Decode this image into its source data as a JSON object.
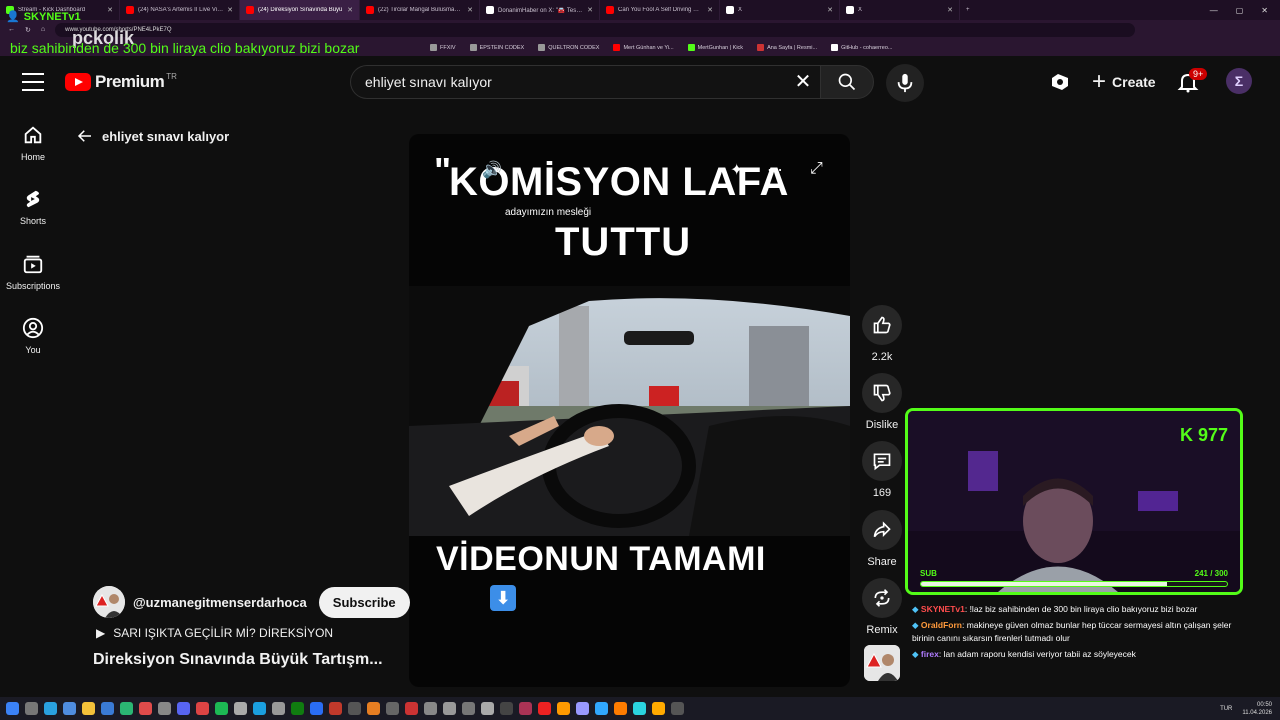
{
  "browser": {
    "tabs": [
      {
        "title": "Stream - Kick Dashboard",
        "color": "#53fc18",
        "active": false
      },
      {
        "title": "(24) NASA's Artemis II Live Views f",
        "color": "#ff0000",
        "active": false
      },
      {
        "title": "(24) Direksiyon Sınavında Büyü",
        "color": "#ff0000",
        "active": true
      },
      {
        "title": "(22) Tircilar Mangal Bulusmasi Vor",
        "color": "#ff0000",
        "active": false
      },
      {
        "title": "DonanimHaber on X: \"🚘 Tesla, Tü",
        "color": "#ffffff",
        "active": false
      },
      {
        "title": "Can You Fool A Self Driving Car?",
        "color": "#ff0000",
        "active": false
      },
      {
        "title": "X",
        "color": "#ffffff",
        "active": false
      },
      {
        "title": "X",
        "color": "#ffffff",
        "active": false
      }
    ],
    "url": "www.youtube.com/shorts/PNE4LPkE7Q",
    "bookmarks": [
      {
        "label": "FFXIV",
        "color": "#999999"
      },
      {
        "label": "EPSTEIN CODEX",
        "color": "#999999"
      },
      {
        "label": "QUELTRON CODEX",
        "color": "#999999"
      },
      {
        "label": "Mert Günhan ve Yi...",
        "color": "#ff0000"
      },
      {
        "label": "MertGunhan | Kick",
        "color": "#53fc18"
      },
      {
        "label": "Ana Sayfa | Resmi...",
        "color": "#cc3333"
      },
      {
        "label": "GitHub - cohaerreo...",
        "color": "#ffffff"
      }
    ]
  },
  "overlay": {
    "streamer": "SKYNETv1",
    "ticker": "biz sahibinden de 300 bin liraya clio bakıyoruz bizi bozar",
    "logo_text": "pckolik"
  },
  "yt_header": {
    "logo_word": "Premium",
    "region": "TR",
    "search_value": "ehliyet sınavı kalıyor",
    "create_label": "Create",
    "notif_badge": "9+",
    "accent": "#ff0000"
  },
  "nav": {
    "items": [
      {
        "label": "Home",
        "icon": "home-icon"
      },
      {
        "label": "Shorts",
        "icon": "shorts-icon"
      },
      {
        "label": "Subscriptions",
        "icon": "subscriptions-icon"
      },
      {
        "label": "You",
        "icon": "you-icon"
      }
    ]
  },
  "back": {
    "label": "ehliyet sınavı kalıyor"
  },
  "video": {
    "quote": "\"",
    "line1": "KOMİSYON LAFA",
    "line_small": "adayımızın mesleği",
    "line2": "TUTTU",
    "line3": "VİDEONUN TAMAMI",
    "arrow": "⬇"
  },
  "channel": {
    "handle": "@uzmanegitmenserdarhoca",
    "subscribe_label": "Subscribe",
    "sound": "SARI IŞIKTA GEÇİLİR Mİ? DİREKSİYON",
    "title": "Direksiyon Sınavında Büyük Tartışm..."
  },
  "actions": {
    "like_count": "2.2k",
    "dislike_label": "Dislike",
    "comment_count": "169",
    "share_label": "Share",
    "remix_label": "Remix"
  },
  "webcam": {
    "counter": "K 977",
    "sub_label": "SUB",
    "sub_count": "241 / 300",
    "sub_progress": 0.803,
    "accent": "#53fc18"
  },
  "chat": [
    {
      "user": "SKYNETv1",
      "user_color": "#ff4d4d",
      "text": ": !laz biz sahibinden de 300 bin liraya clio bakıyoruz bizi bozar"
    },
    {
      "user": "OraldForn",
      "user_color": "#ff9a3c",
      "text": ": makineye güven olmaz bunlar hep tüccar sermayesi altın çalışan şeler birinin canını sıkarsın firenleri tutmadı olur"
    },
    {
      "user": "firex",
      "user_color": "#b07cff",
      "text": ": lan adam raporu kendisi veriyor tabii az söyleyecek"
    }
  ],
  "taskbar": {
    "lang": "TUR",
    "time": "00:50",
    "date": "11.04.2026"
  }
}
